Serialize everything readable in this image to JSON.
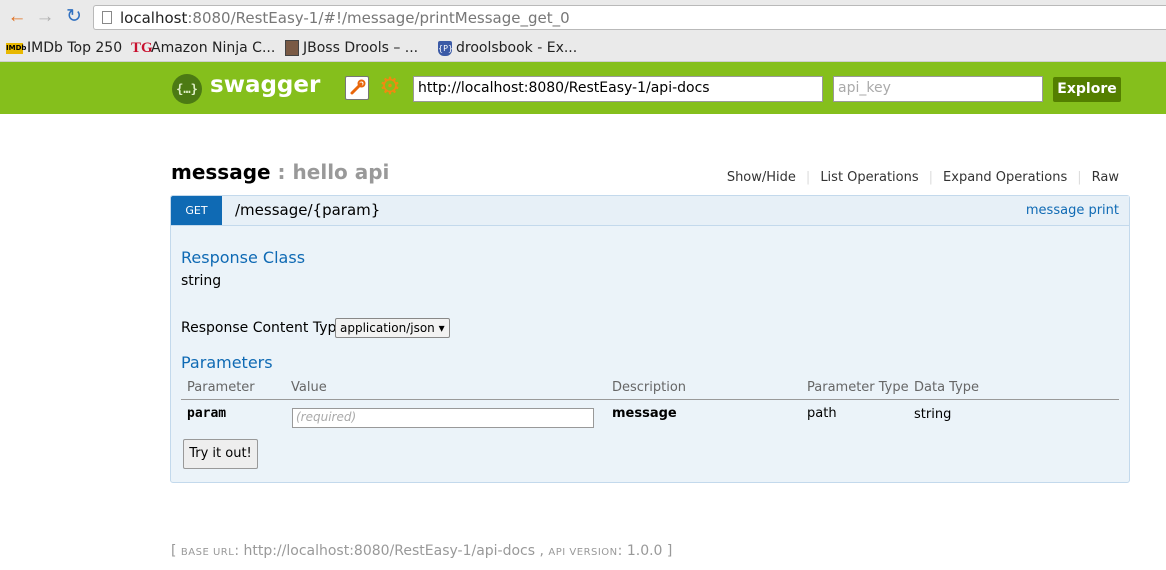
{
  "browser": {
    "url_host": "localhost",
    "url_rest": ":8080/RestEasy-1/#!/message/printMessage_get_0",
    "bookmarks": [
      {
        "icon": "imdb-icon",
        "icon_text": "IMDb",
        "label": "IMDb Top 250"
      },
      {
        "icon": "tg-icon",
        "icon_text": "TG",
        "label": "Amazon Ninja C..."
      },
      {
        "icon": "photo-icon",
        "icon_text": "",
        "label": "JBoss Drools – ..."
      },
      {
        "icon": "drools-icon",
        "icon_text": "{P}",
        "label": "droolsbook - Ex..."
      }
    ]
  },
  "header": {
    "logo_glyph": "{…}",
    "title": "swagger",
    "api_url": "http://localhost:8080/RestEasy-1/api-docs",
    "api_key_placeholder": "api_key",
    "explore_label": "Explore",
    "accent_color": "#85bf1c"
  },
  "resource": {
    "name": "message",
    "separator": " : ",
    "description": "hello api",
    "links": [
      "Show/Hide",
      "List Operations",
      "Expand Operations",
      "Raw"
    ]
  },
  "operation": {
    "method": "GET",
    "path": "/message/{param}",
    "summary": "message print",
    "response_class_title": "Response Class",
    "response_class": "string",
    "content_type_label": "Response Content Type",
    "content_type_value": "application/json",
    "parameters_title": "Parameters",
    "columns": [
      "Parameter",
      "Value",
      "Description",
      "Parameter Type",
      "Data Type"
    ],
    "params": [
      {
        "name": "param",
        "placeholder": "(required)",
        "description": "message",
        "param_type": "path",
        "data_type": "string"
      }
    ],
    "try_label": "Try it out!"
  },
  "footer": {
    "open": "[ ",
    "base_url_label": "BASE URL",
    "base_url": ": http://localhost:8080/RestEasy-1/api-docs , ",
    "api_version_label": "API VERSION",
    "api_version": ": 1.0.0 ]"
  }
}
